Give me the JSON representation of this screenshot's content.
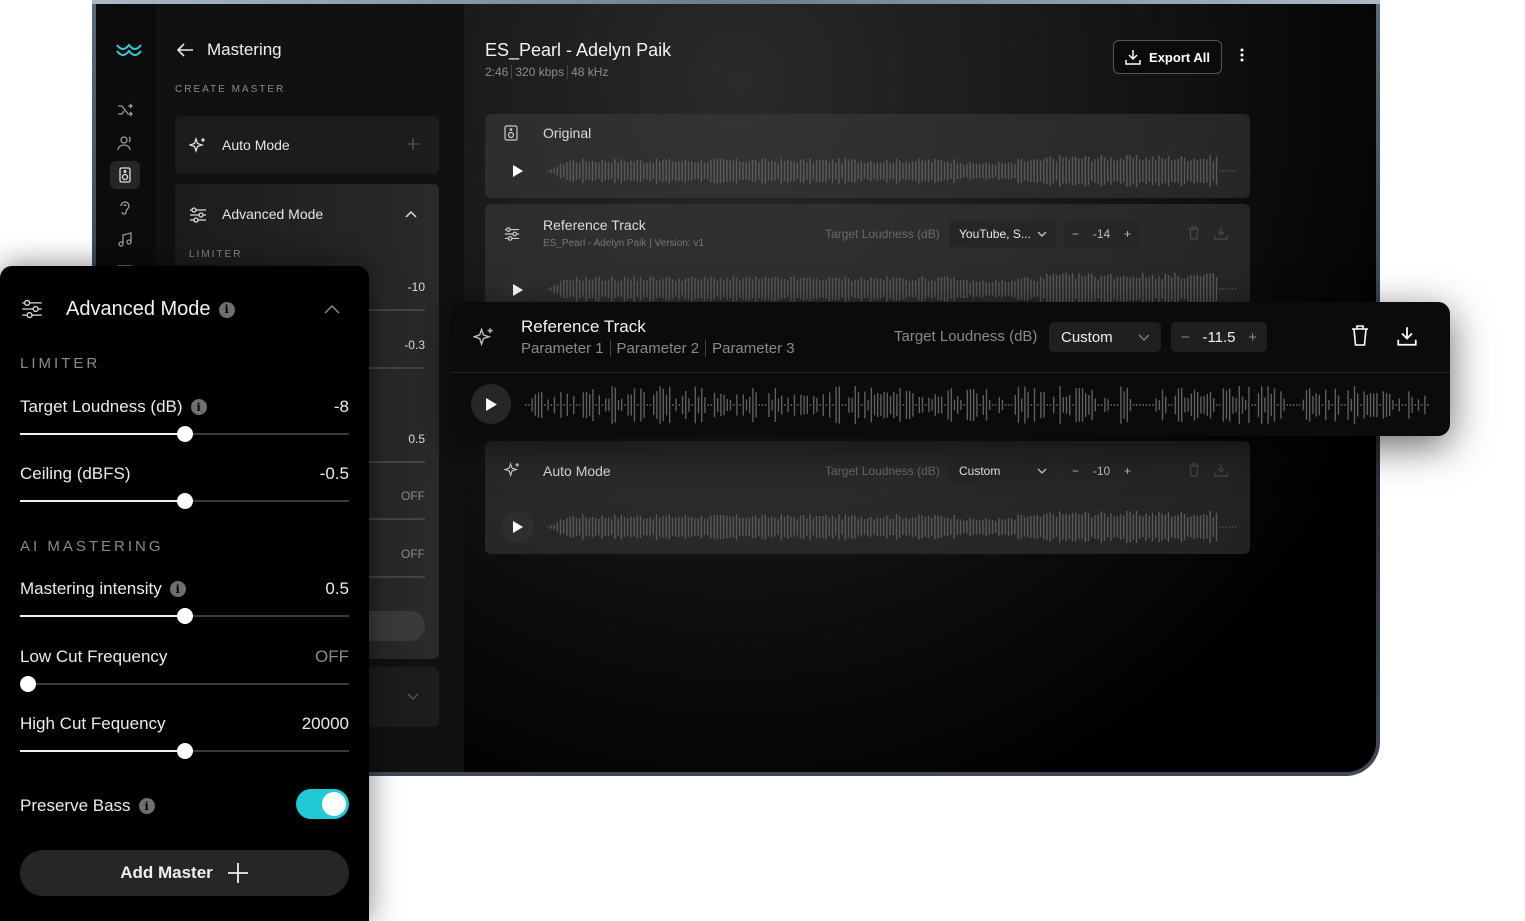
{
  "app": {
    "logo": "waves-logo"
  },
  "sidebar": {
    "back_icon": "arrow-left-icon",
    "title": "Mastering",
    "create_label": "CREATE MASTER",
    "auto_mode_label": "Auto Mode",
    "advanced_mode_label": "Advanced Mode",
    "limiter_label": "LIMITER",
    "bg_values": [
      "-10",
      "-0.3",
      "0.5",
      "OFF",
      "OFF"
    ]
  },
  "track": {
    "title": "ES_Pearl - Adelyn Paik",
    "meta": [
      "2:46",
      "320 kbps",
      "48 kHz"
    ],
    "export_label": "Export All"
  },
  "rows": {
    "original": {
      "name": "Original"
    },
    "reference": {
      "name": "Reference Track",
      "sub": [
        "ES_Pearl - Adelyn Paik",
        "Version: v1"
      ],
      "target_label": "Target Loudness (dB)",
      "preset": "YouTube, S...",
      "value": "-14"
    },
    "auto": {
      "name": "Auto Mode",
      "target_label": "Target Loudness (dB)",
      "preset": "Custom",
      "value": "-10"
    }
  },
  "ref_card": {
    "title": "Reference Track",
    "params": [
      "Parameter 1",
      "Parameter 2",
      "Parameter 3"
    ],
    "target_label": "Target Loudness (dB)",
    "preset": "Custom",
    "value": "-11.5"
  },
  "advanced": {
    "title": "Advanced Mode",
    "limiter_label": "LIMITER",
    "ai_label": "AI MASTERING",
    "sliders": [
      {
        "label": "Target Loudness (dB)",
        "value": "-8",
        "fraction": 0.5
      },
      {
        "label": "Ceiling (dBFS)",
        "value": "-0.5",
        "fraction": 0.5
      },
      {
        "label": "Mastering intensity",
        "value": "0.5",
        "fraction": 0.5
      },
      {
        "label": "Low Cut Frequency",
        "value": "OFF",
        "fraction": 0.0
      },
      {
        "label": "High Cut Fequency",
        "value": "20000",
        "fraction": 0.5
      }
    ],
    "preserve_bass_label": "Preserve Bass",
    "preserve_bass_on": true,
    "add_master_label": "Add Master",
    "accent": "#22c8d6"
  }
}
